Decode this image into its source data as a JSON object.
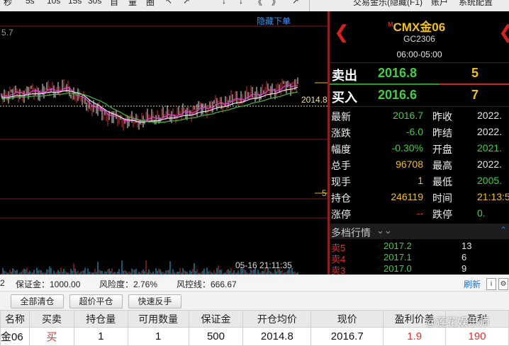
{
  "toolbar": {
    "items": [
      "秒",
      "5s",
      "10s",
      "15s",
      "30s",
      "自",
      "量",
      "圈",
      "↖",
      "↗",
      "↓",
      "↓",
      "《",
      "》",
      "↗"
    ],
    "right_items": [
      "交易金乐(隐藏(F1)",
      "账户",
      "系统配置"
    ]
  },
  "chart": {
    "hide_label": "隐藏下单",
    "top_value": "5.7",
    "ref_price": "2014.8",
    "volume_scale": "5",
    "cursor_time": "05-16 21:11:35"
  },
  "quote": {
    "title": "CMX金06",
    "title_prefix": "M",
    "code": "GC2306",
    "hours": "06:00-05:00",
    "sell_label": "卖出",
    "sell_price": "2016.8",
    "sell_vol": "5",
    "buy_label": "买入",
    "buy_price": "2016.6",
    "buy_vol": "7",
    "stats": [
      {
        "k1": "最新",
        "v1": "2016.7",
        "k2": "昨收",
        "v2": "2022.",
        "c1": "#40d040",
        "c2": "#e6e6e6"
      },
      {
        "k1": "涨跌",
        "v1": "-6.0",
        "k2": "昨结",
        "v2": "2022.",
        "c1": "#40d040",
        "c2": "#e6e6e6"
      },
      {
        "k1": "幅度",
        "v1": "-0.30%",
        "k2": "开盘",
        "v2": "2021.",
        "c1": "#40d040",
        "c2": "#40d040"
      },
      {
        "k1": "总手",
        "v1": "96708",
        "k2": "最高",
        "v2": "2022.",
        "c1": "#f0c020",
        "c2": "#e6e6e6"
      },
      {
        "k1": "现手",
        "v1": "1",
        "k2": "最低",
        "v2": "2005.",
        "c1": "#f0c020",
        "c2": "#40d040"
      },
      {
        "k1": "持仓",
        "v1": "246119",
        "k2": "时间",
        "v2": "21:13:5",
        "c1": "#f0c020",
        "c2": "#f0c020"
      },
      {
        "k1": "涨停",
        "v1": "--",
        "k2": "跌停",
        "v2": "0.",
        "c1": "#e03030",
        "c2": "#40d040"
      }
    ],
    "depth_title": "多档行情",
    "depth": [
      {
        "k": "卖5",
        "p": "2017.2",
        "v": "13"
      },
      {
        "k": "卖4",
        "p": "2017.1",
        "v": "6"
      },
      {
        "k": "卖3",
        "p": "2017.0",
        "v": "9"
      }
    ]
  },
  "account": {
    "left_cut": "2",
    "margin_label": "保证金：1000.00",
    "risk_label": "风险度：2.76%",
    "stop_label": "风控线：666.67",
    "refresh": "刷新"
  },
  "buttons": [
    "全部清仓",
    "超价平仓",
    "快速反手"
  ],
  "positions": {
    "headers": [
      "名称",
      "买卖",
      "持仓量",
      "可用数量",
      "保证金",
      "开仓均价",
      "现价",
      "盈利价差",
      "盈利"
    ],
    "rows": [
      {
        "name": "金06",
        "side": "买",
        "qty": "1",
        "avail": "1",
        "margin": "500",
        "open": "2014.8",
        "price": "2016.7",
        "diff": "1.9",
        "profit": "190"
      }
    ]
  },
  "watermark": "@莲花娱乐师",
  "colors": {
    "up": "#e03030",
    "down": "#40d040",
    "accent": "#f0c020",
    "link": "#3b95f4"
  }
}
